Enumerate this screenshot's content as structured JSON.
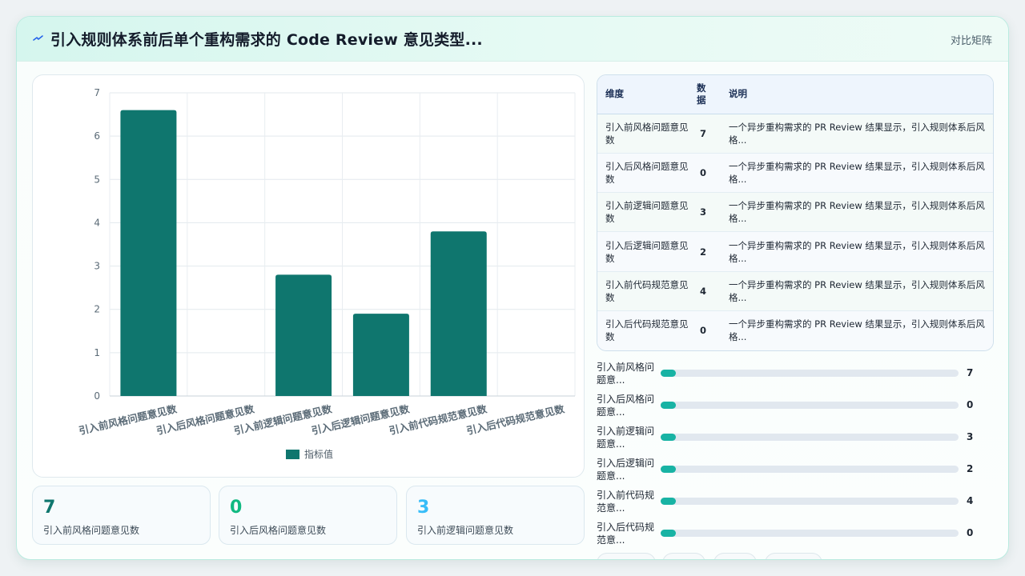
{
  "header": {
    "title": "引入规则体系前后单个重构需求的 Code Review 意见类型...",
    "right_label": "对比矩阵",
    "icon": "pulse-icon",
    "accent": "#0f766e"
  },
  "chart_data": {
    "type": "bar",
    "categories": [
      "引入前风格问题意见数",
      "引入后风格问题意见数",
      "引入前逻辑问题意见数",
      "引入后逻辑问题意见数",
      "引入前代码规范意见数",
      "引入后代码规范意见数"
    ],
    "series": [
      {
        "name": "指标值",
        "values": [
          6.6,
          0,
          2.8,
          1.9,
          3.8,
          0
        ],
        "color": "#0f766e"
      }
    ],
    "yticks": [
      "0",
      "1",
      "2",
      "3",
      "4",
      "5",
      "6",
      "7"
    ],
    "ylim": [
      0,
      7
    ],
    "grid": true,
    "legend_position": "bottom"
  },
  "kpis": [
    {
      "value": "7",
      "label": "引入前风格问题意见数",
      "color": "#0f766e"
    },
    {
      "value": "0",
      "label": "引入后风格问题意见数",
      "color": "#10b981"
    },
    {
      "value": "3",
      "label": "引入前逻辑问题意见数",
      "color": "#38bdf8"
    }
  ],
  "table": {
    "headers": [
      "维度",
      "数据",
      "说明"
    ],
    "rows": [
      {
        "dim": "引入前风格问题意见数",
        "value": "7",
        "desc": "一个异步重构需求的 PR Review 结果显示，引入规则体系后风格..."
      },
      {
        "dim": "引入后风格问题意见数",
        "value": "0",
        "desc": "一个异步重构需求的 PR Review 结果显示，引入规则体系后风格..."
      },
      {
        "dim": "引入前逻辑问题意见数",
        "value": "3",
        "desc": "一个异步重构需求的 PR Review 结果显示，引入规则体系后风格..."
      },
      {
        "dim": "引入后逻辑问题意见数",
        "value": "2",
        "desc": "一个异步重构需求的 PR Review 结果显示，引入规则体系后风格..."
      },
      {
        "dim": "引入前代码规范意见数",
        "value": "4",
        "desc": "一个异步重构需求的 PR Review 结果显示，引入规则体系后风格..."
      },
      {
        "dim": "引入后代码规范意见数",
        "value": "0",
        "desc": "一个异步重构需求的 PR Review 结果显示，引入规则体系后风格..."
      }
    ]
  },
  "bars": [
    {
      "label": "引入前风格问题意...",
      "value": "7",
      "fraction": 0.05
    },
    {
      "label": "引入后风格问题意...",
      "value": "0",
      "fraction": 0.05
    },
    {
      "label": "引入前逻辑问题意...",
      "value": "3",
      "fraction": 0.05
    },
    {
      "label": "引入后逻辑问题意...",
      "value": "2",
      "fraction": 0.05
    },
    {
      "label": "引入前代码规范意...",
      "value": "4",
      "fraction": 0.05
    },
    {
      "label": "引入后代码规范意...",
      "value": "0",
      "fraction": 0.05
    }
  ]
}
